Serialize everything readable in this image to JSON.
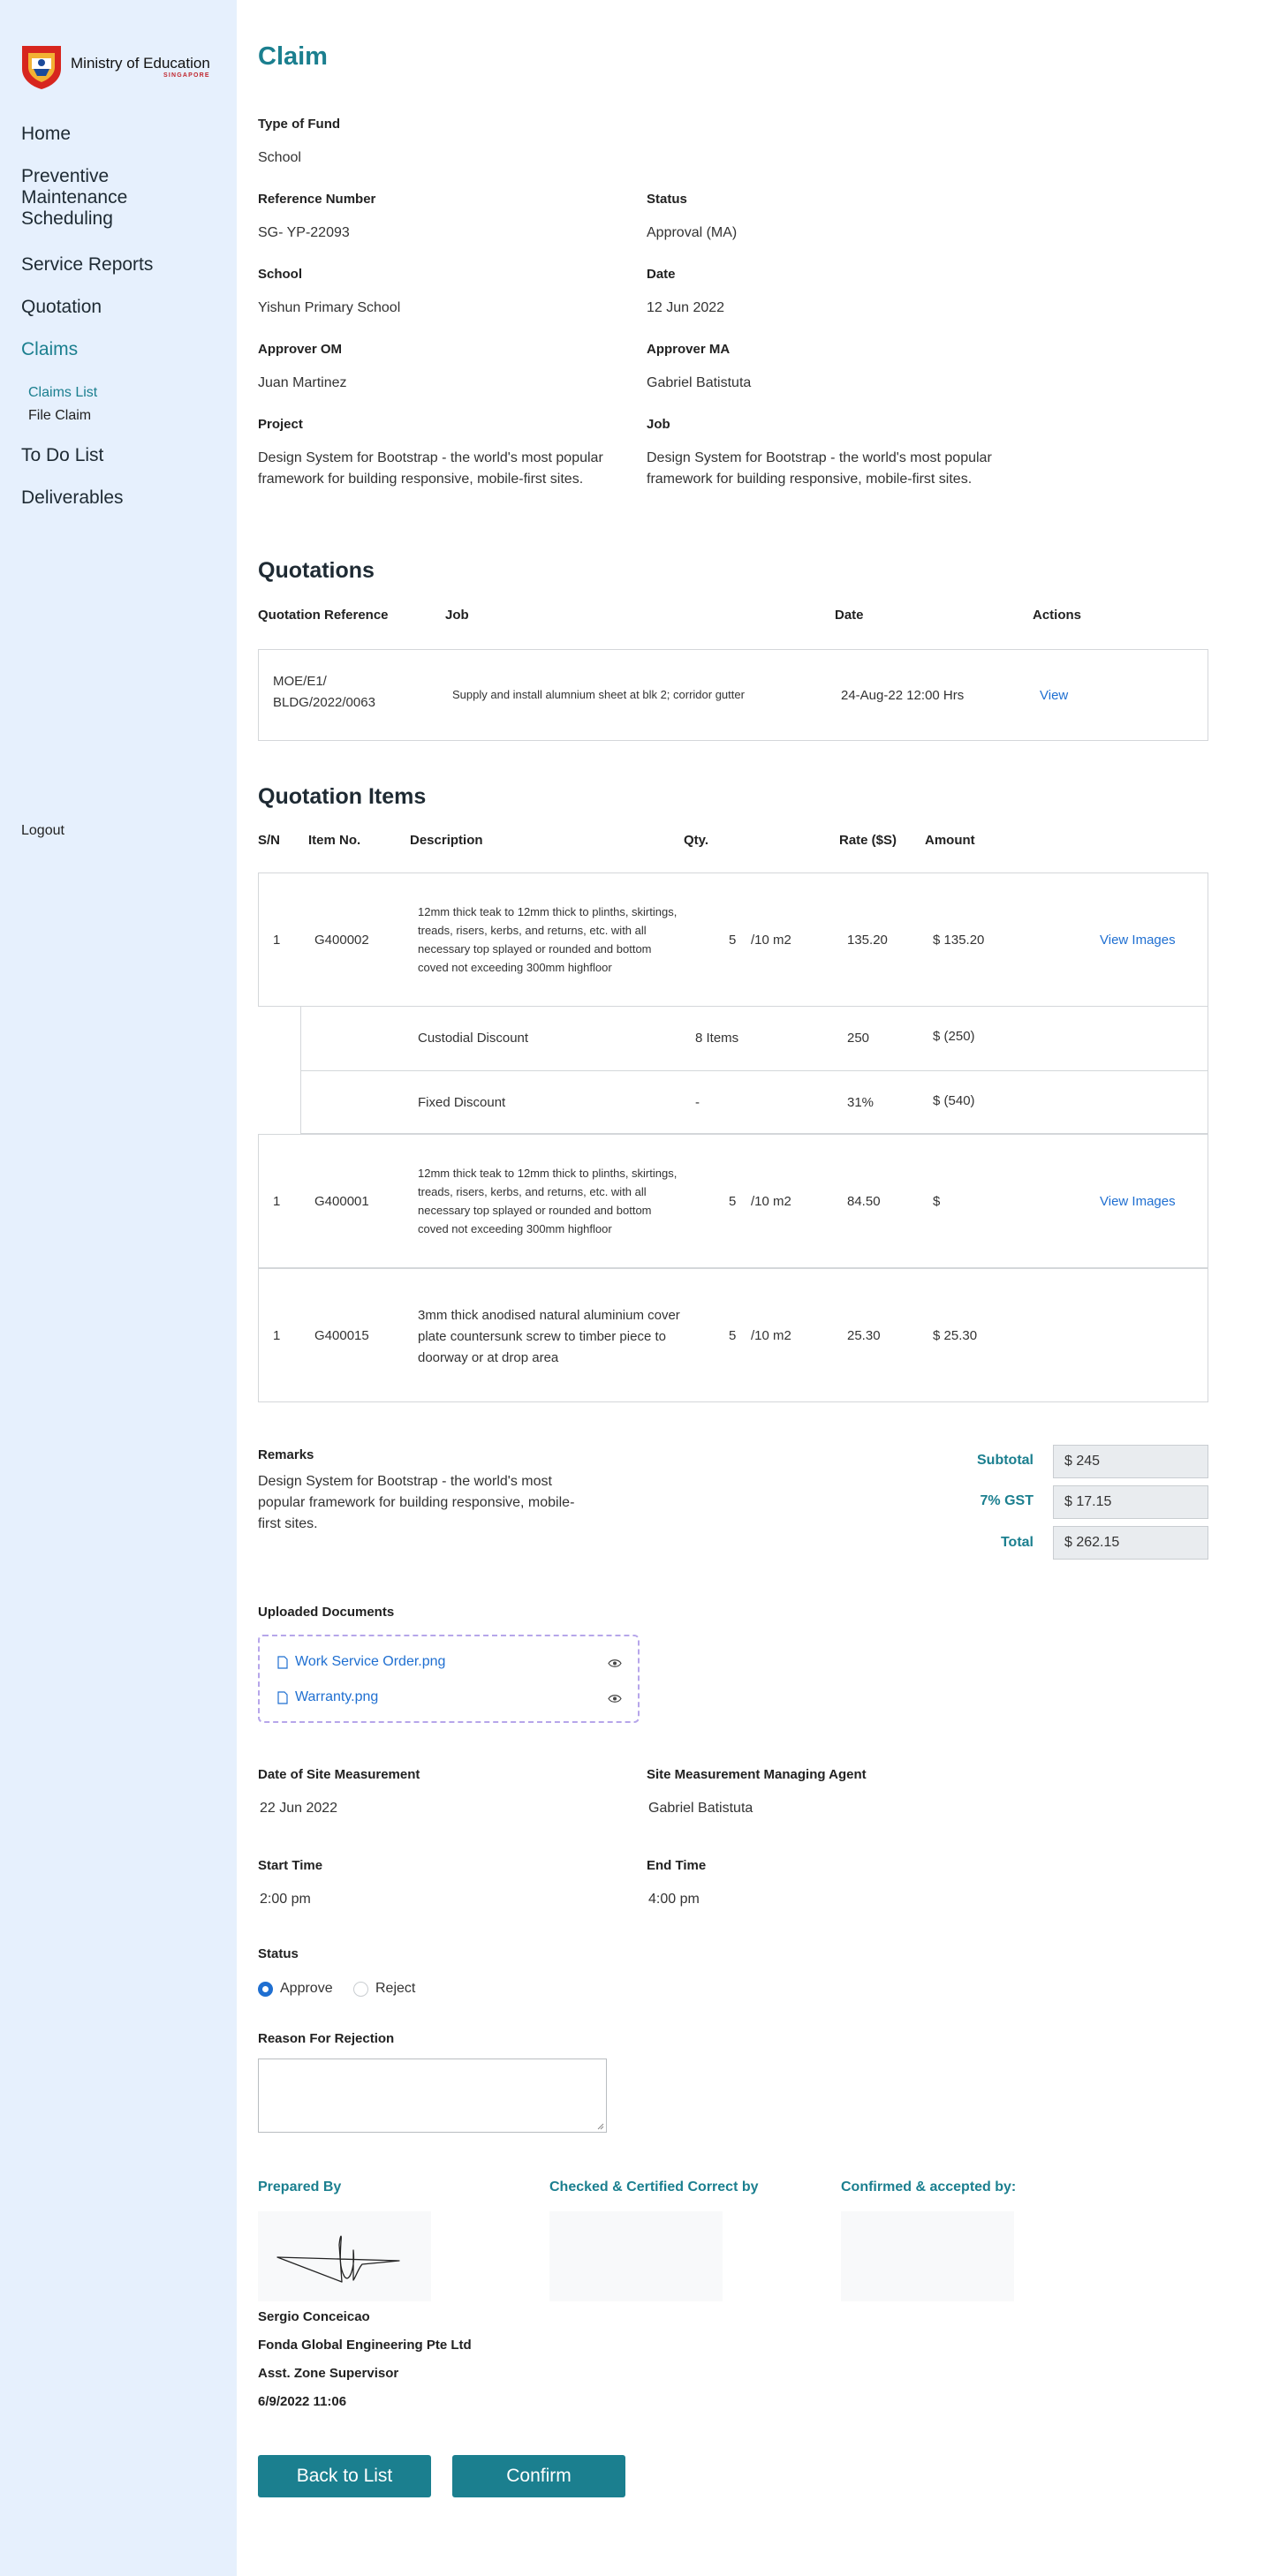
{
  "brand": {
    "name": "Ministry of Education",
    "sub": "SINGAPORE"
  },
  "sidebar": {
    "items": [
      {
        "label": "Home"
      },
      {
        "label": "Preventive Maintenance Scheduling"
      },
      {
        "label": "Service Reports"
      },
      {
        "label": "Quotation"
      },
      {
        "label": "Claims"
      },
      {
        "label": "To Do List"
      },
      {
        "label": "Deliverables"
      }
    ],
    "sub_items": [
      {
        "label": "Claims List"
      },
      {
        "label": "File Claim"
      }
    ],
    "logout": "Logout"
  },
  "page": {
    "title": "Claim"
  },
  "claim": {
    "type_of_fund": {
      "label": "Type of Fund",
      "value": "School"
    },
    "reference_number": {
      "label": "Reference Number",
      "value": "SG- YP-22093"
    },
    "status": {
      "label": "Status",
      "value": "Approval (MA)"
    },
    "school": {
      "label": "School",
      "value": "Yishun Primary School"
    },
    "date": {
      "label": "Date",
      "value": "12 Jun 2022"
    },
    "approver_om": {
      "label": "Approver OM",
      "value": "Juan Martinez"
    },
    "approver_ma": {
      "label": "Approver MA",
      "value": "Gabriel Batistuta"
    },
    "project": {
      "label": "Project",
      "value": "Design System for Bootstrap - the world's most popular framework for building responsive, mobile-first sites."
    },
    "job": {
      "label": "Job",
      "value": "Design System for Bootstrap - the world's most popular framework for building responsive, mobile-first sites."
    }
  },
  "quotations": {
    "title": "Quotations",
    "headers": [
      "Quotation Reference",
      "Job",
      "Date",
      "Actions"
    ],
    "rows": [
      {
        "ref": "MOE/E1/ BLDG/2022/0063",
        "job": "Supply and install alumnium sheet at blk 2; corridor gutter",
        "date": "24-Aug-22 12:00 Hrs",
        "action": "View"
      }
    ]
  },
  "items": {
    "title": "Quotation Items",
    "headers": [
      "S/N",
      "Item No.",
      "Description",
      "Qty.",
      "Rate ($S)",
      "Amount"
    ],
    "rows": [
      {
        "sn": "1",
        "item": "G400002",
        "desc": "12mm thick teak to 12mm thick to plinths, skirtings, treads, risers, kerbs, and returns, etc. with all necessary top splayed or rounded and bottom coved not exceeding 300mm highfloor",
        "qty": "5",
        "unit": "/10 m2",
        "rate": "135.20",
        "amount": "$ 135.20",
        "action": "View Images"
      },
      {
        "sn": "1",
        "item": "G400001",
        "desc": "12mm thick teak to 12mm thick to plinths, skirtings, treads, risers, kerbs, and returns, etc. with all necessary top splayed or rounded and bottom coved not exceeding 300mm highfloor",
        "qty": "5",
        "unit": "/10 m2",
        "rate": "84.50",
        "amount": "$",
        "action": "View Images"
      },
      {
        "sn": "1",
        "item": "G400015",
        "desc": "3mm thick anodised natural aluminium cover plate countersunk screw to timber piece to doorway or at drop area",
        "qty": "5",
        "unit": "/10 m2",
        "rate": "25.30",
        "amount": "$ 25.30"
      }
    ],
    "discounts": [
      {
        "name": "Custodial Discount",
        "qty": "8 Items",
        "rate": "250",
        "amount": "$ (250)"
      },
      {
        "name": "Fixed Discount",
        "qty": "-",
        "rate": "31%",
        "amount": "$  (540)"
      }
    ]
  },
  "remarks": {
    "label": "Remarks",
    "value": "Design System for Bootstrap - the world's most popular framework for building responsive, mobile-first sites."
  },
  "totals": {
    "subtotal_label": "Subtotal",
    "subtotal": "$ 245",
    "gst_label": "7% GST",
    "gst": "$ 17.15",
    "total_label": "Total",
    "total": "$ 262.15"
  },
  "documents": {
    "label": "Uploaded Documents",
    "files": [
      "Work Service Order.png",
      "Warranty.png"
    ]
  },
  "site": {
    "date_label": "Date of Site Measurement",
    "date": "22 Jun 2022",
    "agent_label": "Site Measurement Managing Agent",
    "agent": "Gabriel Batistuta",
    "start_label": "Start Time",
    "start": "2:00 pm",
    "end_label": "End Time",
    "end": "4:00 pm"
  },
  "decision": {
    "label": "Status",
    "approve": "Approve",
    "reject": "Reject",
    "selected": "Approve",
    "reason_label": "Reason For Rejection"
  },
  "signatures": {
    "prepared_by": "Prepared By",
    "checked_by": "Checked & Certified Correct by",
    "confirmed_by": "Confirmed & accepted by:",
    "name": "Sergio Conceicao",
    "company": "Fonda Global Engineering Pte Ltd",
    "role": "Asst. Zone Supervisor",
    "timestamp": "6/9/2022 11:06"
  },
  "buttons": {
    "back": "Back to List",
    "confirm": "Confirm"
  },
  "colors": {
    "accent": "#1b7f8f",
    "link": "#1f6fd1",
    "sidebar_bg": "#e6f0fd"
  }
}
